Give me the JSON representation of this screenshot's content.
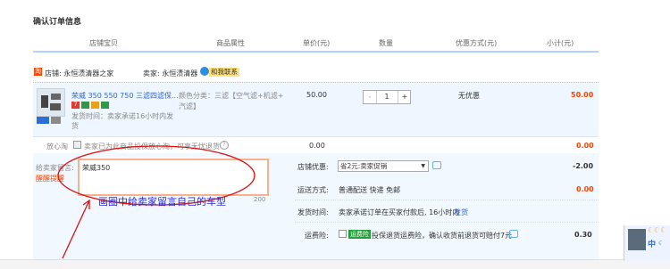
{
  "page_title": "确认订单信息",
  "headers": [
    "店铺宝贝",
    "商品属性",
    "单价(元)",
    "数量",
    "优惠方式(元)",
    "小计(元)"
  ],
  "shop": {
    "icon_text": "淘",
    "name": "店铺: 永恒渍清器之家",
    "seller": "卖家: 永恒渍清器",
    "contact": "和我联系"
  },
  "item": {
    "title_l1": "荣威 350 550 750 三滤四滤保...",
    "title_l2": "发货时间：卖家承诺16小时内发",
    "title_l3": "货",
    "attr_l1": "颜色分类：三滤【空气滤+机滤+",
    "attr_l2": "汽滤】",
    "price": "50.00",
    "quantity": "1",
    "minus": "-",
    "plus": "+",
    "discount": "无优惠",
    "subtotal": "50.00"
  },
  "reassure": {
    "label": "放心淘",
    "text": "卖家已为此商品投保放心淘，可享无忧退货",
    "price": "0.00",
    "subtotal": "0.00"
  },
  "message": {
    "label": "给卖家留言:",
    "sub_label": "醒醒提醒",
    "value": "荣威350",
    "counter": "200"
  },
  "promo": {
    "label": "店铺优惠:",
    "value": "省2元:卖家促销",
    "amount": "-2.00"
  },
  "shipping": {
    "label": "运送方式:",
    "value": "普通配送 快递 免邮",
    "amount": "0.00"
  },
  "delivery": {
    "label": "发货时间:",
    "value": "卖家承诺订单在买家付款后, 16小时内",
    "link": "发货"
  },
  "insurance": {
    "label": "运费险:",
    "badge": "运费险",
    "text": "投保退货运费险，确认收货前退货可赔付7元",
    "amount": "0.30"
  },
  "annotation": "画圈中给卖家留言自己的车型",
  "ime": {
    "label": "中"
  },
  "colors": {
    "accent": "#f40",
    "annotation": "#2c2cd6",
    "header_line": "#b2d1ff",
    "item_bg": "#eef6ff"
  }
}
